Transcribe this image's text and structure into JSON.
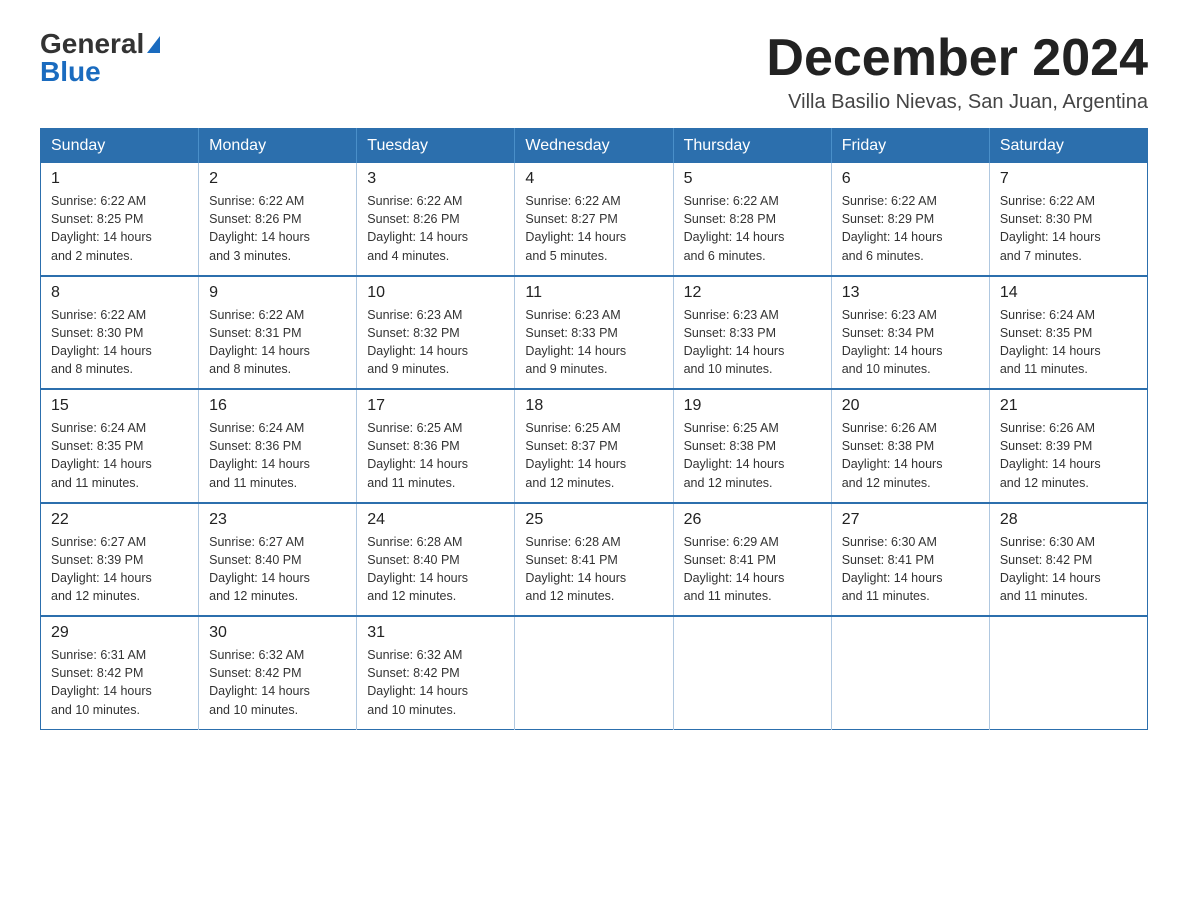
{
  "logo": {
    "general": "General",
    "blue": "Blue"
  },
  "title": "December 2024",
  "location": "Villa Basilio Nievas, San Juan, Argentina",
  "days_of_week": [
    "Sunday",
    "Monday",
    "Tuesday",
    "Wednesday",
    "Thursday",
    "Friday",
    "Saturday"
  ],
  "weeks": [
    [
      {
        "day": "1",
        "sunrise": "6:22 AM",
        "sunset": "8:25 PM",
        "daylight": "14 hours and 2 minutes."
      },
      {
        "day": "2",
        "sunrise": "6:22 AM",
        "sunset": "8:26 PM",
        "daylight": "14 hours and 3 minutes."
      },
      {
        "day": "3",
        "sunrise": "6:22 AM",
        "sunset": "8:26 PM",
        "daylight": "14 hours and 4 minutes."
      },
      {
        "day": "4",
        "sunrise": "6:22 AM",
        "sunset": "8:27 PM",
        "daylight": "14 hours and 5 minutes."
      },
      {
        "day": "5",
        "sunrise": "6:22 AM",
        "sunset": "8:28 PM",
        "daylight": "14 hours and 6 minutes."
      },
      {
        "day": "6",
        "sunrise": "6:22 AM",
        "sunset": "8:29 PM",
        "daylight": "14 hours and 6 minutes."
      },
      {
        "day": "7",
        "sunrise": "6:22 AM",
        "sunset": "8:30 PM",
        "daylight": "14 hours and 7 minutes."
      }
    ],
    [
      {
        "day": "8",
        "sunrise": "6:22 AM",
        "sunset": "8:30 PM",
        "daylight": "14 hours and 8 minutes."
      },
      {
        "day": "9",
        "sunrise": "6:22 AM",
        "sunset": "8:31 PM",
        "daylight": "14 hours and 8 minutes."
      },
      {
        "day": "10",
        "sunrise": "6:23 AM",
        "sunset": "8:32 PM",
        "daylight": "14 hours and 9 minutes."
      },
      {
        "day": "11",
        "sunrise": "6:23 AM",
        "sunset": "8:33 PM",
        "daylight": "14 hours and 9 minutes."
      },
      {
        "day": "12",
        "sunrise": "6:23 AM",
        "sunset": "8:33 PM",
        "daylight": "14 hours and 10 minutes."
      },
      {
        "day": "13",
        "sunrise": "6:23 AM",
        "sunset": "8:34 PM",
        "daylight": "14 hours and 10 minutes."
      },
      {
        "day": "14",
        "sunrise": "6:24 AM",
        "sunset": "8:35 PM",
        "daylight": "14 hours and 11 minutes."
      }
    ],
    [
      {
        "day": "15",
        "sunrise": "6:24 AM",
        "sunset": "8:35 PM",
        "daylight": "14 hours and 11 minutes."
      },
      {
        "day": "16",
        "sunrise": "6:24 AM",
        "sunset": "8:36 PM",
        "daylight": "14 hours and 11 minutes."
      },
      {
        "day": "17",
        "sunrise": "6:25 AM",
        "sunset": "8:36 PM",
        "daylight": "14 hours and 11 minutes."
      },
      {
        "day": "18",
        "sunrise": "6:25 AM",
        "sunset": "8:37 PM",
        "daylight": "14 hours and 12 minutes."
      },
      {
        "day": "19",
        "sunrise": "6:25 AM",
        "sunset": "8:38 PM",
        "daylight": "14 hours and 12 minutes."
      },
      {
        "day": "20",
        "sunrise": "6:26 AM",
        "sunset": "8:38 PM",
        "daylight": "14 hours and 12 minutes."
      },
      {
        "day": "21",
        "sunrise": "6:26 AM",
        "sunset": "8:39 PM",
        "daylight": "14 hours and 12 minutes."
      }
    ],
    [
      {
        "day": "22",
        "sunrise": "6:27 AM",
        "sunset": "8:39 PM",
        "daylight": "14 hours and 12 minutes."
      },
      {
        "day": "23",
        "sunrise": "6:27 AM",
        "sunset": "8:40 PM",
        "daylight": "14 hours and 12 minutes."
      },
      {
        "day": "24",
        "sunrise": "6:28 AM",
        "sunset": "8:40 PM",
        "daylight": "14 hours and 12 minutes."
      },
      {
        "day": "25",
        "sunrise": "6:28 AM",
        "sunset": "8:41 PM",
        "daylight": "14 hours and 12 minutes."
      },
      {
        "day": "26",
        "sunrise": "6:29 AM",
        "sunset": "8:41 PM",
        "daylight": "14 hours and 11 minutes."
      },
      {
        "day": "27",
        "sunrise": "6:30 AM",
        "sunset": "8:41 PM",
        "daylight": "14 hours and 11 minutes."
      },
      {
        "day": "28",
        "sunrise": "6:30 AM",
        "sunset": "8:42 PM",
        "daylight": "14 hours and 11 minutes."
      }
    ],
    [
      {
        "day": "29",
        "sunrise": "6:31 AM",
        "sunset": "8:42 PM",
        "daylight": "14 hours and 10 minutes."
      },
      {
        "day": "30",
        "sunrise": "6:32 AM",
        "sunset": "8:42 PM",
        "daylight": "14 hours and 10 minutes."
      },
      {
        "day": "31",
        "sunrise": "6:32 AM",
        "sunset": "8:42 PM",
        "daylight": "14 hours and 10 minutes."
      },
      null,
      null,
      null,
      null
    ]
  ],
  "labels": {
    "sunrise": "Sunrise:",
    "sunset": "Sunset:",
    "daylight": "Daylight:"
  }
}
